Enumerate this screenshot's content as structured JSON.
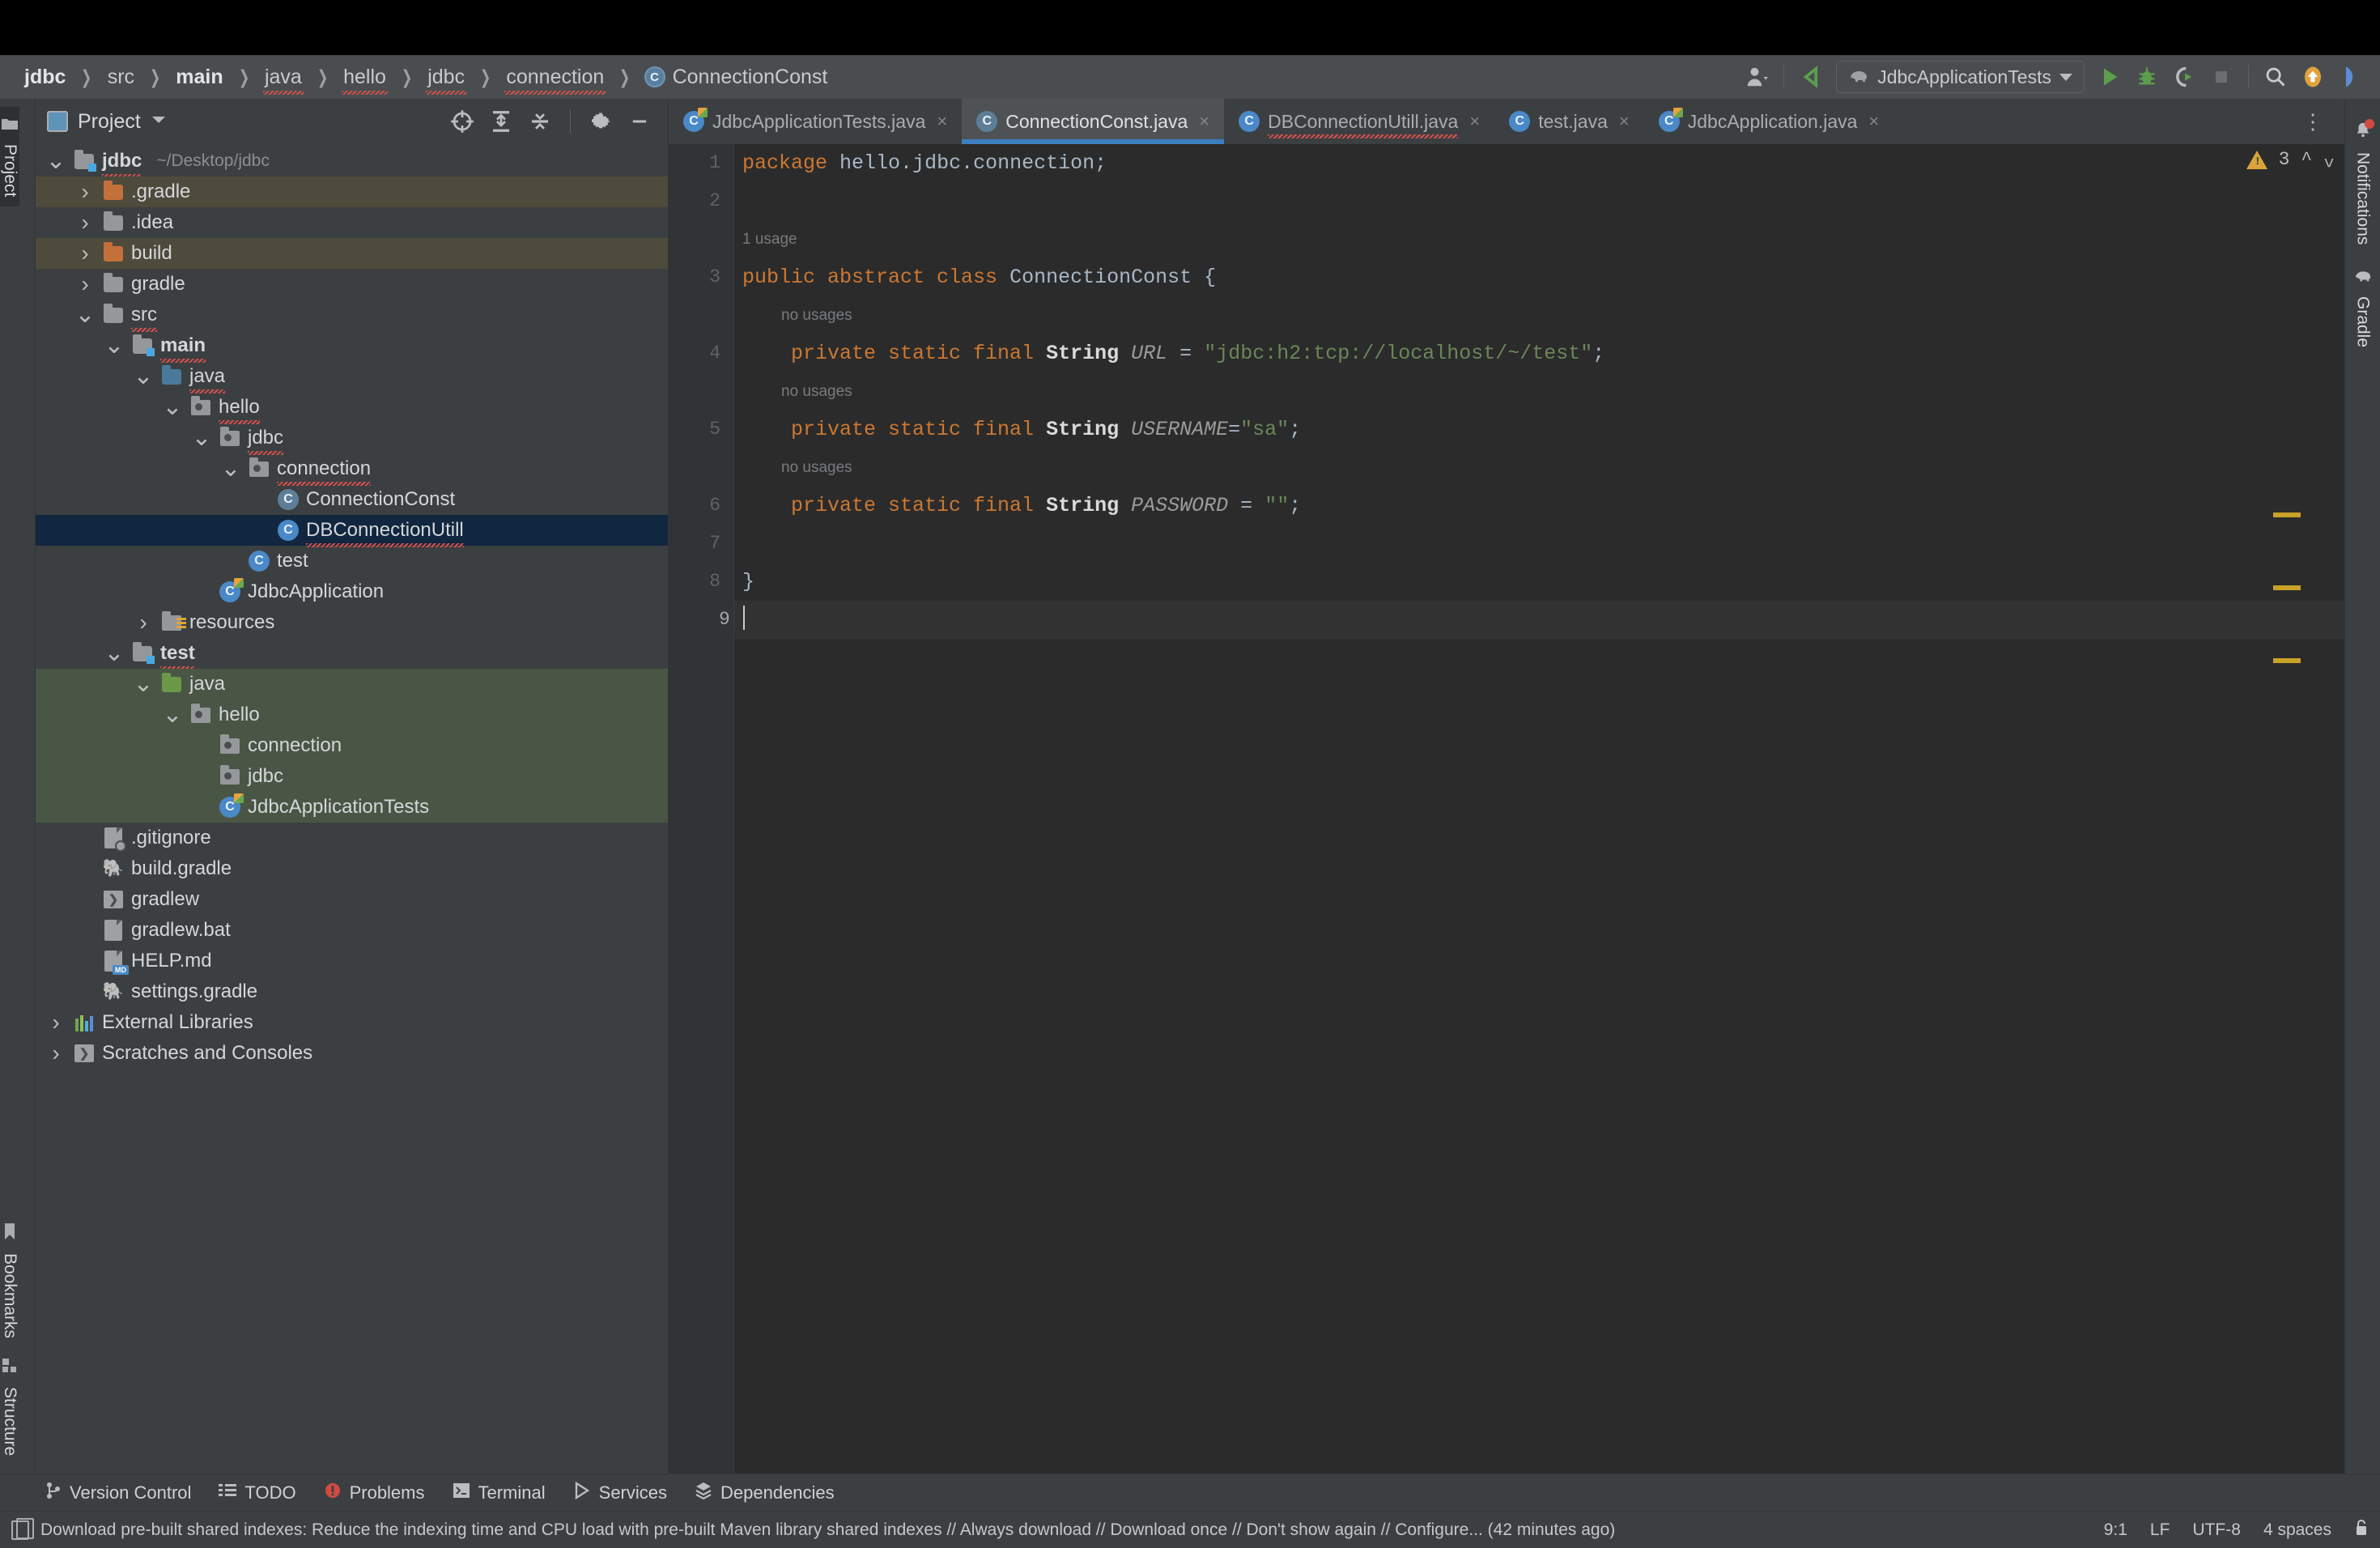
{
  "navbar": {
    "breadcrumbs": [
      {
        "label": "jdbc",
        "bold": true,
        "squiggle": false
      },
      {
        "label": "src",
        "bold": false,
        "squiggle": false
      },
      {
        "label": "main",
        "bold": true,
        "squiggle": false
      },
      {
        "label": "java",
        "bold": false,
        "squiggle": true
      },
      {
        "label": "hello",
        "bold": false,
        "squiggle": true
      },
      {
        "label": "jdbc",
        "bold": false,
        "squiggle": true
      },
      {
        "label": "connection",
        "bold": false,
        "squiggle": true
      }
    ],
    "current_file": "ConnectionConst",
    "current_file_icon": "abstract-class-icon",
    "run_config": "JdbcApplicationTests",
    "run_config_icon": "gradle-elephant-icon",
    "actions": [
      {
        "name": "user-account-icon",
        "glyph": "●"
      },
      {
        "name": "updates-icon",
        "glyph": "↖"
      },
      {
        "name": "run-button",
        "glyph": "▶"
      },
      {
        "name": "debug-button",
        "glyph": "✱"
      },
      {
        "name": "run-with-coverage-button",
        "glyph": "⟳"
      },
      {
        "name": "stop-button",
        "glyph": "■"
      },
      {
        "name": "search-everywhere-icon",
        "glyph": "⌕"
      },
      {
        "name": "vcs-update-icon",
        "glyph": "↑"
      },
      {
        "name": "ai-assistant-icon",
        "glyph": "◖"
      }
    ]
  },
  "leftbar": {
    "top": [
      {
        "label": "Project",
        "icon": "project-folder-icon",
        "active": true
      }
    ],
    "bottom": [
      {
        "label": "Bookmarks",
        "icon": "bookmark-icon",
        "active": false
      },
      {
        "label": "Structure",
        "icon": "structure-icon",
        "active": false
      }
    ]
  },
  "rightbar": [
    {
      "label": "Notifications",
      "icon": "bell-icon",
      "badge": true
    },
    {
      "label": "Gradle",
      "icon": "gradle-elephant-icon",
      "badge": false
    }
  ],
  "project_panel": {
    "title": "Project",
    "title_icon": "project-view-icon",
    "dropdown_icon": "chevron-down-icon",
    "tools": [
      {
        "name": "select-opened-file-icon",
        "glyph": "⊕"
      },
      {
        "name": "expand-all-icon",
        "glyph": "⤓"
      },
      {
        "name": "collapse-all-icon",
        "glyph": "⤒"
      },
      {
        "name": "settings-gear-icon",
        "glyph": "⚙"
      },
      {
        "name": "hide-panel-icon",
        "glyph": "—"
      }
    ],
    "tree": [
      {
        "label": "jdbc",
        "sub": "~/Desktop/jdbc",
        "indent": 0,
        "twist": "open",
        "icon": "module-folder",
        "bold": true,
        "squiggle": true,
        "highlight": "none"
      },
      {
        "label": ".gradle",
        "sub": "",
        "indent": 1,
        "twist": "closed",
        "icon": "folder-orange",
        "bold": false,
        "squiggle": false,
        "highlight": "brown"
      },
      {
        "label": ".idea",
        "sub": "",
        "indent": 1,
        "twist": "closed",
        "icon": "folder-gray",
        "bold": false,
        "squiggle": false,
        "highlight": "none"
      },
      {
        "label": "build",
        "sub": "",
        "indent": 1,
        "twist": "closed",
        "icon": "folder-orange",
        "bold": false,
        "squiggle": false,
        "highlight": "brown"
      },
      {
        "label": "gradle",
        "sub": "",
        "indent": 1,
        "twist": "closed",
        "icon": "folder-gray",
        "bold": false,
        "squiggle": false,
        "highlight": "none"
      },
      {
        "label": "src",
        "sub": "",
        "indent": 1,
        "twist": "open",
        "icon": "folder-gray",
        "bold": false,
        "squiggle": true,
        "highlight": "none"
      },
      {
        "label": "main",
        "sub": "",
        "indent": 2,
        "twist": "open",
        "icon": "module-folder",
        "bold": true,
        "squiggle": true,
        "highlight": "none"
      },
      {
        "label": "java",
        "sub": "",
        "indent": 3,
        "twist": "open",
        "icon": "folder-blue",
        "bold": false,
        "squiggle": true,
        "highlight": "none"
      },
      {
        "label": "hello",
        "sub": "",
        "indent": 4,
        "twist": "open",
        "icon": "package",
        "bold": false,
        "squiggle": true,
        "highlight": "none"
      },
      {
        "label": "jdbc",
        "sub": "",
        "indent": 5,
        "twist": "open",
        "icon": "package",
        "bold": false,
        "squiggle": true,
        "highlight": "none"
      },
      {
        "label": "connection",
        "sub": "",
        "indent": 6,
        "twist": "open",
        "icon": "package",
        "bold": false,
        "squiggle": true,
        "highlight": "none"
      },
      {
        "label": "ConnectionConst",
        "sub": "",
        "indent": 7,
        "twist": "none",
        "icon": "abstract-class",
        "bold": false,
        "squiggle": false,
        "highlight": "none"
      },
      {
        "label": "DBConnectionUtill",
        "sub": "",
        "indent": 7,
        "twist": "none",
        "icon": "class",
        "bold": false,
        "squiggle": true,
        "highlight": "selected"
      },
      {
        "label": "test",
        "sub": "",
        "indent": 6,
        "twist": "none",
        "icon": "class",
        "bold": false,
        "squiggle": false,
        "highlight": "none"
      },
      {
        "label": "JdbcApplication",
        "sub": "",
        "indent": 5,
        "twist": "none",
        "icon": "spring-class",
        "bold": false,
        "squiggle": false,
        "highlight": "none"
      },
      {
        "label": "resources",
        "sub": "",
        "indent": 3,
        "twist": "closed",
        "icon": "resources-folder",
        "bold": false,
        "squiggle": false,
        "highlight": "none"
      },
      {
        "label": "test",
        "sub": "",
        "indent": 2,
        "twist": "open",
        "icon": "module-folder",
        "bold": true,
        "squiggle": true,
        "highlight": "none"
      },
      {
        "label": "java",
        "sub": "",
        "indent": 3,
        "twist": "open",
        "icon": "folder-green",
        "bold": false,
        "squiggle": false,
        "highlight": "green"
      },
      {
        "label": "hello",
        "sub": "",
        "indent": 4,
        "twist": "open",
        "icon": "package",
        "bold": false,
        "squiggle": false,
        "highlight": "green"
      },
      {
        "label": "connection",
        "sub": "",
        "indent": 5,
        "twist": "none",
        "icon": "package",
        "bold": false,
        "squiggle": false,
        "highlight": "green"
      },
      {
        "label": "jdbc",
        "sub": "",
        "indent": 5,
        "twist": "none",
        "icon": "package",
        "bold": false,
        "squiggle": false,
        "highlight": "green"
      },
      {
        "label": "JdbcApplicationTests",
        "sub": "",
        "indent": 5,
        "twist": "none",
        "icon": "spring-class",
        "bold": false,
        "squiggle": false,
        "highlight": "green"
      },
      {
        "label": ".gitignore",
        "sub": "",
        "indent": 1,
        "twist": "none",
        "icon": "gitignore-file",
        "bold": false,
        "squiggle": false,
        "highlight": "none"
      },
      {
        "label": "build.gradle",
        "sub": "",
        "indent": 1,
        "twist": "none",
        "icon": "gradle-file",
        "bold": false,
        "squiggle": false,
        "highlight": "none"
      },
      {
        "label": "gradlew",
        "sub": "",
        "indent": 1,
        "twist": "none",
        "icon": "shell-file",
        "bold": false,
        "squiggle": false,
        "highlight": "none"
      },
      {
        "label": "gradlew.bat",
        "sub": "",
        "indent": 1,
        "twist": "none",
        "icon": "bat-file",
        "bold": false,
        "squiggle": false,
        "highlight": "none"
      },
      {
        "label": "HELP.md",
        "sub": "",
        "indent": 1,
        "twist": "none",
        "icon": "markdown-file",
        "bold": false,
        "squiggle": false,
        "highlight": "none"
      },
      {
        "label": "settings.gradle",
        "sub": "",
        "indent": 1,
        "twist": "none",
        "icon": "gradle-file",
        "bold": false,
        "squiggle": false,
        "highlight": "none"
      },
      {
        "label": "External Libraries",
        "sub": "",
        "indent": 0,
        "twist": "closed",
        "icon": "libraries",
        "bold": false,
        "squiggle": false,
        "highlight": "none"
      },
      {
        "label": "Scratches and Consoles",
        "sub": "",
        "indent": 0,
        "twist": "closed",
        "icon": "scratches",
        "bold": false,
        "squiggle": false,
        "highlight": "none"
      }
    ]
  },
  "editor": {
    "tabs": [
      {
        "label": "JdbcApplicationTests.java",
        "icon": "spring-class",
        "active": false,
        "squiggle": false
      },
      {
        "label": "ConnectionConst.java",
        "icon": "abstract-class",
        "active": true,
        "squiggle": false
      },
      {
        "label": "DBConnectionUtill.java",
        "icon": "class",
        "active": false,
        "squiggle": true
      },
      {
        "label": "test.java",
        "icon": "class",
        "active": false,
        "squiggle": false
      },
      {
        "label": "JdbcApplication.java",
        "icon": "spring-class",
        "active": false,
        "squiggle": false
      }
    ],
    "tab_overflow_icon": "more-options-icon",
    "gutter_lines": [
      "1",
      "2",
      "",
      "3",
      "",
      "4",
      "",
      "5",
      "",
      "6",
      "7",
      "8",
      "9"
    ],
    "lines": [
      {
        "n": "1",
        "type": "code",
        "html": "<span class=\"kw\">package</span> <span class=\"pln\">hello.jdbc.connection</span><span class=\"pln\">;</span>"
      },
      {
        "n": "2",
        "type": "code",
        "html": ""
      },
      {
        "n": "",
        "type": "hint",
        "html": "1 usage",
        "indent": 0
      },
      {
        "n": "3",
        "type": "code",
        "html": "<span class=\"kw\">public abstract class</span> <span class=\"pln\">ConnectionConst {</span>"
      },
      {
        "n": "",
        "type": "hint",
        "html": "no usages",
        "indent": 1
      },
      {
        "n": "4",
        "type": "code",
        "html": "    <span class=\"kw\">private static final</span> <span class=\"typ\">String</span> <span class=\"fld\">URL</span> <span class=\"pln\">=</span> <span class=\"str\">\"jdbc:h2:tcp://localhost/~/test\"</span><span class=\"pln\">;</span>"
      },
      {
        "n": "",
        "type": "hint",
        "html": "no usages",
        "indent": 1
      },
      {
        "n": "5",
        "type": "code",
        "html": "    <span class=\"kw\">private static final</span> <span class=\"typ\">String</span> <span class=\"fld\">USERNAME</span><span class=\"pln\">=</span><span class=\"str\">\"sa\"</span><span class=\"pln\">;</span>"
      },
      {
        "n": "",
        "type": "hint",
        "html": "no usages",
        "indent": 1
      },
      {
        "n": "6",
        "type": "code",
        "html": "    <span class=\"kw\">private static final</span> <span class=\"typ\">String</span> <span class=\"fld\">PASSWORD</span> <span class=\"pln\">=</span> <span class=\"str\">\"\"</span><span class=\"pln\">;</span>"
      },
      {
        "n": "7",
        "type": "code",
        "html": ""
      },
      {
        "n": "8",
        "type": "code",
        "html": "<span class=\"pln\">}</span>"
      },
      {
        "n": "9",
        "type": "caret",
        "html": ""
      }
    ],
    "inspection": {
      "warning_count": "3",
      "warning_icon": "warning-triangle-icon",
      "up_icon": "chevron-up-icon",
      "down_icon": "chevron-down-icon"
    }
  },
  "bottombar": [
    {
      "label": "Version Control",
      "icon": "branch-icon"
    },
    {
      "label": "TODO",
      "icon": "list-icon"
    },
    {
      "label": "Problems",
      "icon": "problems-icon"
    },
    {
      "label": "Terminal",
      "icon": "terminal-icon"
    },
    {
      "label": "Services",
      "icon": "services-icon"
    },
    {
      "label": "Dependencies",
      "icon": "dependencies-icon"
    }
  ],
  "statusbar": {
    "icon": "indexes-icon",
    "message": "Download pre-built shared indexes: Reduce the indexing time and CPU load with pre-built Maven library shared indexes // Always download // Download once // Don't show again // Configure... (42 minutes ago)",
    "caret_position": "9:1",
    "line_separator": "LF",
    "encoding": "UTF-8",
    "indent": "4 spaces",
    "lock_icon": "lock-icon"
  },
  "colors": {
    "accent_blue": "#3d7fc1",
    "selection": "#11263f",
    "test_green": "#4a5645",
    "excluded_brown": "#4e4a3c",
    "keyword_orange": "#cc7832",
    "string_green": "#6a8759",
    "warning_yellow": "#d9a43b"
  }
}
